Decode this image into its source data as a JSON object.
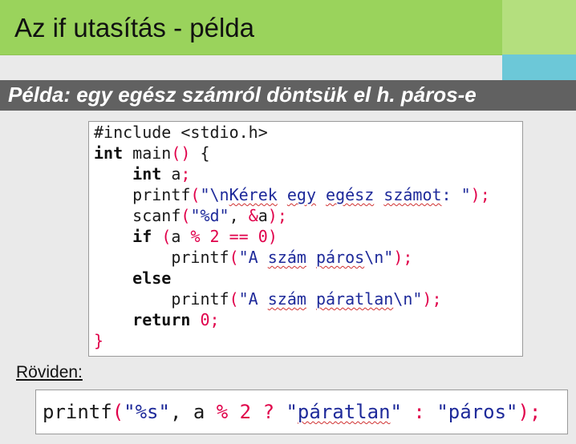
{
  "slide": {
    "title": "Az if utasítás - példa",
    "subtitle": "Példa: egy egész számról döntsük el h. páros-e",
    "short_label": "Röviden:"
  },
  "code": {
    "l1": "#include <stdio.h>",
    "l2_kw": "int",
    "l2_rest": " main",
    "l2_paren": "()",
    "l2_brace": " {",
    "l3_indent": "    ",
    "l3_kw": "int",
    "l3_rest": " a",
    "l3_semi": ";",
    "l4_indent": "    ",
    "l4_fn": "printf",
    "l4_open": "(",
    "l4_str1": "\"\\n",
    "l4_w1": "Kérek",
    "l4_sp1": " ",
    "l4_w2": "egy",
    "l4_sp2": " ",
    "l4_w3": "egész",
    "l4_sp3": " ",
    "l4_w4": "számot",
    "l4_str2": ": \"",
    "l4_close": ");",
    "l5_indent": "    ",
    "l5_fn": "scanf",
    "l5_open": "(",
    "l5_str": "\"%d\"",
    "l5_comma": ", ",
    "l5_amp": "&",
    "l5_a": "a",
    "l5_close": ");",
    "l6_indent": "    ",
    "l6_kw": "if",
    "l6_sp": " ",
    "l6_open": "(",
    "l6_a": "a ",
    "l6_mod": "%",
    "l6_sp2": " ",
    "l6_two": "2",
    "l6_sp3": " ",
    "l6_eq": "==",
    "l6_sp4": " ",
    "l6_zero": "0",
    "l6_close": ")",
    "l7_indent": "        ",
    "l7_fn": "printf",
    "l7_open": "(",
    "l7_s1": "\"A ",
    "l7_w1": "szám",
    "l7_s2": " ",
    "l7_w2": "páros",
    "l7_s3": "\\n\"",
    "l7_close": ");",
    "l8_indent": "    ",
    "l8_kw": "else",
    "l9_indent": "        ",
    "l9_fn": "printf",
    "l9_open": "(",
    "l9_s1": "\"A ",
    "l9_w1": "szám",
    "l9_s2": " ",
    "l9_w2": "páratlan",
    "l9_s3": "\\n\"",
    "l9_close": ");",
    "l10_indent": "    ",
    "l10_kw": "return",
    "l10_sp": " ",
    "l10_zero": "0",
    "l10_semi": ";",
    "l11": "}"
  },
  "short": {
    "fn": "printf",
    "open": "(",
    "fmt": "\"%s\"",
    "comma": ", a ",
    "mod": "%",
    "sp1": " ",
    "two": "2",
    "sp2": " ",
    "q": "?",
    "sp3": " ",
    "s1a": "\"",
    "w1": "páratlan",
    "s1b": "\"",
    "colon": " : ",
    "s2": "\"páros\"",
    "close": ");"
  },
  "colors": {
    "title_bar": "#9ad35c",
    "subtitle_bar": "#616161",
    "accent_cyan": "#6cc8d8",
    "code_operator": "#e0004a",
    "code_string": "#1e2a9a"
  }
}
